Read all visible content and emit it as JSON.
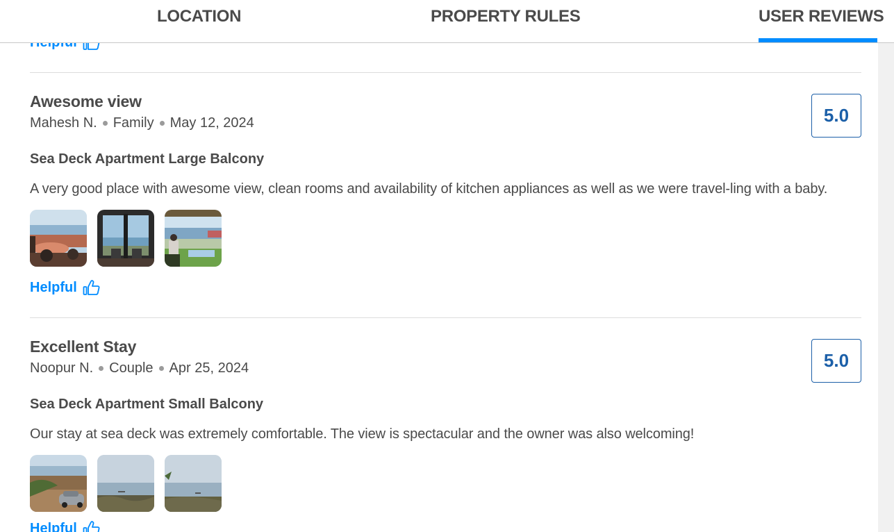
{
  "tabs": {
    "location": "LOCATION",
    "property_rules": "PROPERTY RULES",
    "user_reviews": "USER REVIEWS",
    "active": "user_reviews"
  },
  "helpful_label": "Helpful",
  "reviews": [
    {
      "title": "Awesome view",
      "author": "Mahesh N.",
      "traveler_type": "Family",
      "date": "May 12, 2024",
      "room": "Sea Deck Apartment Large Balcony",
      "text": "A very good place with awesome view, clean rooms and availability of kitchen appliances as well as we were travel-ling with a baby.",
      "score": "5.0",
      "photo_count": 3,
      "helpful_label": "Helpful"
    },
    {
      "title": "Excellent Stay",
      "author": "Noopur N.",
      "traveler_type": "Couple",
      "date": "Apr 25, 2024",
      "room": "Sea Deck Apartment Small Balcony",
      "text": "Our stay at sea deck was extremely comfortable. The view is spectacular and the owner was also welcoming!",
      "score": "5.0",
      "photo_count": 3,
      "helpful_label": "Helpful"
    }
  ],
  "colors": {
    "accent_blue": "#008cff",
    "score_blue": "#1b5fa8",
    "text_dark": "#4a4a4a",
    "divider": "#dcdcdc"
  },
  "icons": {
    "helpful": "thumbs-up-icon"
  }
}
